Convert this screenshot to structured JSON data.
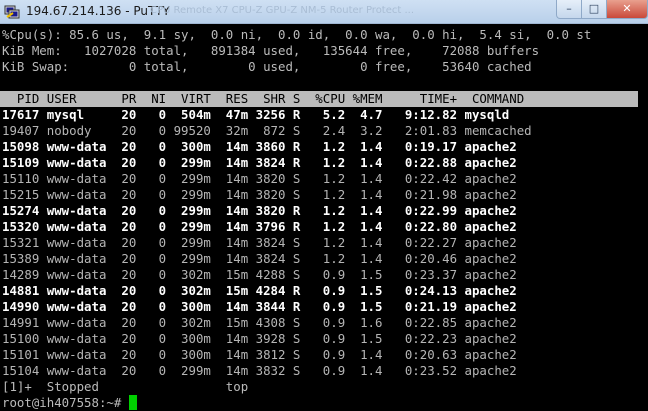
{
  "window": {
    "title": "194.67.214.136 - PuTTY",
    "ghost_title": "CPU Remote X7 CPU-Z GPU-Z NM-5 Router Protect ...",
    "min_label": "–",
    "max_label": "□",
    "close_label": "✕"
  },
  "colors": {
    "terminal_bg": "#000000",
    "text": "#bbbbbb",
    "bold_text": "#ffffff",
    "header_bg": "#bbbbbb",
    "cursor": "#00d000"
  },
  "top_summary": [
    "%Cpu(s): 85.6 us,  9.1 sy,  0.0 ni,  0.0 id,  0.0 wa,  0.0 hi,  5.4 si,  0.0 st",
    "KiB Mem:   1027028 total,   891384 used,   135644 free,    72088 buffers",
    "KiB Swap:        0 total,        0 used,        0 free,    53640 cached"
  ],
  "table_header": "  PID USER      PR  NI  VIRT  RES  SHR S  %CPU %MEM     TIME+  COMMAND",
  "processes": [
    {
      "text": "17617 mysql     20   0  504m  47m 3256 R   5.2  4.7   9:12.82 mysqld",
      "bold": true
    },
    {
      "text": "19407 nobody    20   0 99520  32m  872 S   2.4  3.2   2:01.83 memcached",
      "bold": false
    },
    {
      "text": "15098 www-data  20   0  300m  14m 3860 R   1.2  1.4   0:19.17 apache2",
      "bold": true
    },
    {
      "text": "15109 www-data  20   0  299m  14m 3824 R   1.2  1.4   0:22.88 apache2",
      "bold": true
    },
    {
      "text": "15110 www-data  20   0  299m  14m 3820 S   1.2  1.4   0:22.42 apache2",
      "bold": false
    },
    {
      "text": "15215 www-data  20   0  299m  14m 3820 S   1.2  1.4   0:21.98 apache2",
      "bold": false
    },
    {
      "text": "15274 www-data  20   0  299m  14m 3820 R   1.2  1.4   0:22.99 apache2",
      "bold": true
    },
    {
      "text": "15320 www-data  20   0  299m  14m 3796 R   1.2  1.4   0:22.80 apache2",
      "bold": true
    },
    {
      "text": "15321 www-data  20   0  299m  14m 3824 S   1.2  1.4   0:22.27 apache2",
      "bold": false
    },
    {
      "text": "15389 www-data  20   0  299m  14m 3824 S   1.2  1.4   0:20.46 apache2",
      "bold": false
    },
    {
      "text": "14289 www-data  20   0  302m  15m 4288 S   0.9  1.5   0:23.37 apache2",
      "bold": false
    },
    {
      "text": "14881 www-data  20   0  302m  15m 4284 R   0.9  1.5   0:24.13 apache2",
      "bold": true
    },
    {
      "text": "14990 www-data  20   0  300m  14m 3844 R   0.9  1.5   0:21.19 apache2",
      "bold": true
    },
    {
      "text": "14991 www-data  20   0  302m  15m 4308 S   0.9  1.6   0:22.85 apache2",
      "bold": false
    },
    {
      "text": "15100 www-data  20   0  300m  14m 3928 S   0.9  1.5   0:22.23 apache2",
      "bold": false
    },
    {
      "text": "15101 www-data  20   0  300m  14m 3812 S   0.9  1.4   0:20.63 apache2",
      "bold": false
    },
    {
      "text": "15104 www-data  20   0  299m  14m 3832 S   0.9  1.4   0:23.52 apache2",
      "bold": false
    }
  ],
  "job_status": "[1]+  Stopped                 top",
  "prompt": "root@ih407558:~# "
}
